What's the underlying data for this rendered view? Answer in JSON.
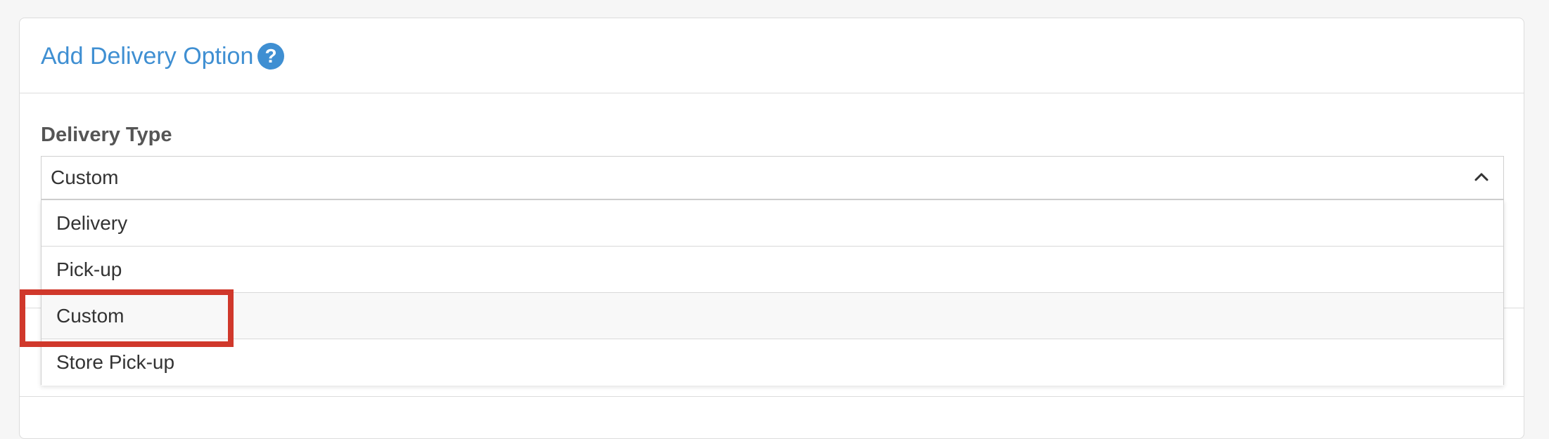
{
  "panel": {
    "title": "Add Delivery Option",
    "help_icon": "question-circle-icon"
  },
  "field": {
    "label": "Delivery Type",
    "selected_value": "Custom",
    "dropdown_open": true
  },
  "dropdown": {
    "options": [
      {
        "label": "Delivery"
      },
      {
        "label": "Pick-up"
      },
      {
        "label": "Custom"
      },
      {
        "label": "Store Pick-up"
      }
    ],
    "hovered_option": "Custom"
  },
  "annotation": {
    "highlight_color": "#d0382b",
    "highlighted_item": "Custom"
  },
  "colors": {
    "accent": "#3f8fd2",
    "page_background": "#f6f6f6"
  }
}
